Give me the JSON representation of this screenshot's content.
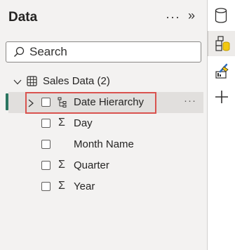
{
  "pane": {
    "title": "Data",
    "more_label": "···",
    "collapse_label": "»"
  },
  "search": {
    "placeholder": "Search",
    "value": ""
  },
  "tree": {
    "table": {
      "name": "Sales Data (2)",
      "icon": "table-icon"
    },
    "fields": [
      {
        "label": "Date Hierarchy",
        "icon": "hierarchy-icon",
        "selected": false
      },
      {
        "label": "Day",
        "icon": "sigma-icon",
        "selected": false
      },
      {
        "label": "Month Name",
        "icon": "",
        "selected": false
      },
      {
        "label": "Quarter",
        "icon": "sigma-icon",
        "selected": false
      },
      {
        "label": "Year",
        "icon": "sigma-icon",
        "selected": false
      }
    ],
    "row_more_label": "···"
  },
  "rail": {
    "buttons": [
      "data-icon",
      "model-icon",
      "format-icon",
      "add-icon"
    ]
  },
  "colors": {
    "accent": "#2a7560",
    "highlight": "#d9534f",
    "pane_bg": "#f3f2f1",
    "selected_row": "#e1dfdd"
  }
}
